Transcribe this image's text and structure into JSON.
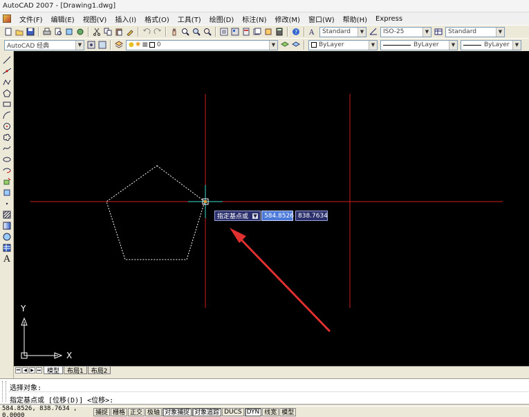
{
  "window": {
    "title": "AutoCAD 2007 - [Drawing1.dwg]"
  },
  "menu": {
    "items": [
      "文件(F)",
      "编辑(E)",
      "视图(V)",
      "插入(I)",
      "格式(O)",
      "工具(T)",
      "绘图(D)",
      "标注(N)",
      "修改(M)",
      "窗口(W)",
      "帮助(H)",
      "Express"
    ]
  },
  "toolbar1": {
    "text_style": "Standard",
    "dim_style": "ISO-25",
    "table_style": "Standard",
    "icons": [
      "new-icon",
      "open-icon",
      "save-icon",
      "print-icon",
      "preview-icon",
      "publish-icon",
      "cut-icon",
      "copy-icon",
      "paste-icon",
      "matchprop-icon",
      "undo-icon",
      "redo-icon",
      "pan-icon",
      "zoom-realtime-icon",
      "zoom-window-icon",
      "zoom-previous-icon",
      "properties-icon",
      "designcenter-icon",
      "toolpalettes-icon",
      "sheetset-icon",
      "markup-icon",
      "calculator-icon",
      "help-icon"
    ]
  },
  "toolbar2": {
    "workspace": "AutoCAD 经典",
    "layer": "0",
    "color": "ByLayer",
    "linetype": "ByLayer",
    "lineweight": "ByLayer"
  },
  "draw_tools": [
    "line-icon",
    "construction-line-icon",
    "polyline-icon",
    "polygon-icon",
    "rectangle-icon",
    "arc-icon",
    "circle-icon",
    "revcloud-icon",
    "spline-icon",
    "ellipse-icon",
    "ellipse-arc-icon",
    "insert-block-icon",
    "make-block-icon",
    "point-icon",
    "hatch-icon",
    "gradient-icon",
    "region-icon",
    "table-icon",
    "mtext-icon"
  ],
  "dynamic_input": {
    "prompt": "指定基点或",
    "x_value": "584.8526",
    "y_value": "838.7634"
  },
  "ucs": {
    "x_label": "X",
    "y_label": "Y"
  },
  "layout_tabs": {
    "tabs": [
      "模型",
      "布局1",
      "布局2"
    ],
    "active": 0
  },
  "command_line": {
    "history": "选择对象:",
    "prompt": "指定基点或 [位移(D)] <位移>:"
  },
  "status": {
    "coordinates": "584.8526,  838.7634 , 0.0000",
    "buttons": [
      "捕捉",
      "栅格",
      "正交",
      "极轴",
      "对象捕捉",
      "对象追踪",
      "DUCS",
      "DYN",
      "线宽",
      "模型"
    ],
    "on_states": [
      false,
      false,
      false,
      false,
      true,
      true,
      false,
      true,
      false,
      false
    ]
  },
  "colors": {
    "canvas": "#000000",
    "crosshair_horizontal": "#d02020",
    "crosshair_vertical": "#d02020",
    "arrow": "#e03030",
    "pentagon": "#ffffff"
  }
}
